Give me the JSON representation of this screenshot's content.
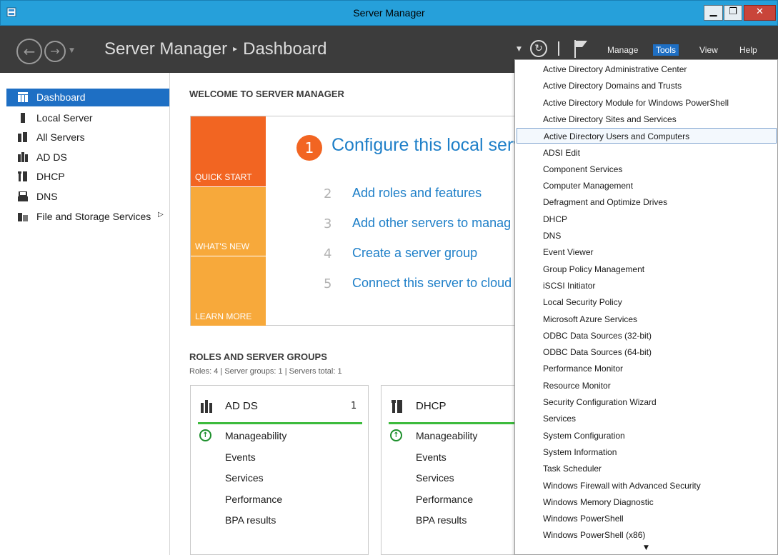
{
  "window": {
    "title": "Server Manager"
  },
  "header": {
    "breadcrumb_root": "Server Manager",
    "breadcrumb_sep": "▸",
    "breadcrumb_page": "Dashboard",
    "menu": {
      "manage": "Manage",
      "tools": "Tools",
      "view": "View",
      "help": "Help"
    }
  },
  "sidebar": {
    "items": [
      {
        "label": "Dashboard",
        "icon": "dashboard-icon"
      },
      {
        "label": "Local Server",
        "icon": "local-server-icon"
      },
      {
        "label": "All Servers",
        "icon": "all-servers-icon"
      },
      {
        "label": "AD DS",
        "icon": "ad-ds-icon"
      },
      {
        "label": "DHCP",
        "icon": "dhcp-icon"
      },
      {
        "label": "DNS",
        "icon": "dns-icon"
      },
      {
        "label": "File and Storage Services",
        "icon": "file-storage-icon"
      }
    ]
  },
  "welcome": {
    "title": "WELCOME TO SERVER MANAGER",
    "tiles": {
      "quick_start": "QUICK START",
      "whats_new": "WHAT'S NEW",
      "learn_more": "LEARN MORE"
    },
    "step1": {
      "num": "1",
      "text": "Configure this local serve"
    },
    "steps": [
      {
        "num": "2",
        "text": "Add roles and features"
      },
      {
        "num": "3",
        "text": "Add other servers to manag"
      },
      {
        "num": "4",
        "text": "Create a server group"
      },
      {
        "num": "5",
        "text": "Connect this server to cloud"
      }
    ]
  },
  "roles": {
    "title": "ROLES AND SERVER GROUPS",
    "summary": "Roles: 4  |  Server groups: 1  |  Servers total: 1",
    "cards": [
      {
        "title": "AD DS",
        "count": "1",
        "lines": [
          "Manageability",
          "Events",
          "Services",
          "Performance",
          "BPA results"
        ]
      },
      {
        "title": "DHCP",
        "count": "",
        "lines": [
          "Manageability",
          "Events",
          "Services",
          "Performance",
          "BPA results"
        ]
      }
    ]
  },
  "tools_menu": {
    "highlighted_index": 4,
    "items": [
      "Active Directory Administrative Center",
      "Active Directory Domains and Trusts",
      "Active Directory Module for Windows PowerShell",
      "Active Directory Sites and Services",
      "Active Directory Users and Computers",
      "ADSI Edit",
      "Component Services",
      "Computer Management",
      "Defragment and Optimize Drives",
      "DHCP",
      "DNS",
      "Event Viewer",
      "Group Policy Management",
      "iSCSI Initiator",
      "Local Security Policy",
      "Microsoft Azure Services",
      "ODBC Data Sources (32-bit)",
      "ODBC Data Sources (64-bit)",
      "Performance Monitor",
      "Resource Monitor",
      "Security Configuration Wizard",
      "Services",
      "System Configuration",
      "System Information",
      "Task Scheduler",
      "Windows Firewall with Advanced Security",
      "Windows Memory Diagnostic",
      "Windows PowerShell",
      "Windows PowerShell (x86)"
    ]
  },
  "colors": {
    "accent": "#1e6fc4",
    "title_bar": "#26a0da",
    "quick_start": "#f26522",
    "tile": "#f7a93b",
    "status_ok": "#3dbb3d"
  }
}
